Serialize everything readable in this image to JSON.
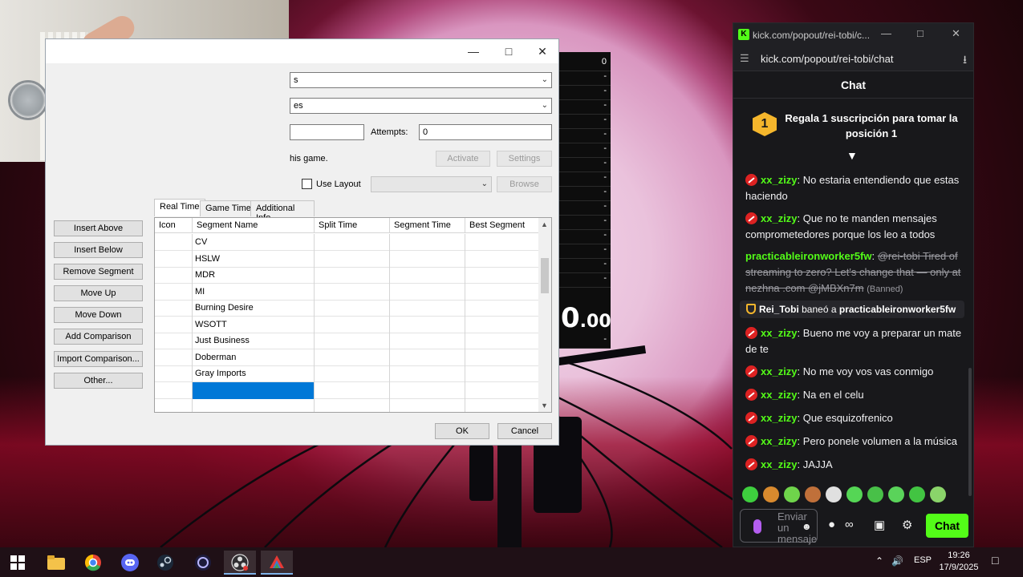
{
  "splits_editor": {
    "combo1_value": "s",
    "combo2_value": "es",
    "attempts_label": "Attempts:",
    "attempts_value": "0",
    "game_text": "his game.",
    "activate_label": "Activate",
    "settings_label": "Settings",
    "use_layout_label": "Use Layout",
    "browse_label": "Browse",
    "side_buttons": [
      "Insert Above",
      "Insert Below",
      "Remove Segment",
      "Move Up",
      "Move Down",
      "Add Comparison",
      "Import Comparison...",
      "Other..."
    ],
    "tabs": [
      "Real Time",
      "Game Time",
      "Additional Info"
    ],
    "columns": [
      "Icon",
      "Segment Name",
      "Split Time",
      "Segment Time",
      "Best Segment"
    ],
    "rows": [
      {
        "name": "CV"
      },
      {
        "name": "HSLW"
      },
      {
        "name": "MDR"
      },
      {
        "name": "MI"
      },
      {
        "name": "Burning Desire"
      },
      {
        "name": "WSOTT"
      },
      {
        "name": "Just Business"
      },
      {
        "name": "Doberman"
      },
      {
        "name": "Gray Imports"
      },
      {
        "name": ""
      },
      {
        "name": ""
      }
    ],
    "ok_label": "OK",
    "cancel_label": "Cancel"
  },
  "timer": {
    "first_value": "0",
    "dash": "-",
    "big_value": "0",
    "big_fraction": ".00"
  },
  "chat": {
    "window_title": "kick.com/popout/rei-tobi/c...",
    "url": "kick.com/popout/rei-tobi/chat",
    "header": "Chat",
    "promo_rank": "1",
    "promo_text": "Regala 1 suscripción para tomar la posición 1",
    "messages": [
      {
        "user": "xx_zizy",
        "text": "No estaria entendiendo que estas haciendo"
      },
      {
        "user": "xx_zizy",
        "text": "Que no te manden mensajes comprometedores porque los leo a todos"
      },
      {
        "user": "practicableironworker5fw",
        "text": "@rei-tobi Tired of streaming to zero? Let's change that — only at nezhna .com @jMBXn7m",
        "tag": "(Banned)"
      },
      {
        "user": "xx_zizy",
        "text": "Bueno me voy a preparar un mate de te"
      },
      {
        "user": "xx_zizy",
        "text": "No me voy vos vas conmigo"
      },
      {
        "user": "xx_zizy",
        "text": "Na en el celu"
      },
      {
        "user": "xx_zizy",
        "text": "Que esquizofrenico"
      },
      {
        "user": "xx_zizy",
        "text": "Pero ponele volumen a la música"
      },
      {
        "user": "xx_zizy",
        "text": "JAJJA"
      }
    ],
    "mod_action": {
      "moderator": "Rei_Tobi",
      "action": "baneó a",
      "target": "practicableironworker5fw"
    },
    "input_placeholder": "Enviar un mensaje",
    "send_label": "Chat",
    "emote_colors": [
      "#3ecf3e",
      "#d98a2e",
      "#6fd44b",
      "#c0703a",
      "#e0e0e0",
      "#55d655",
      "#48c048",
      "#5ad35a",
      "#42c442",
      "#8ad46a"
    ]
  },
  "taskbar": {
    "language": "ESP",
    "time": "19:26",
    "date": "17/9/2025"
  }
}
